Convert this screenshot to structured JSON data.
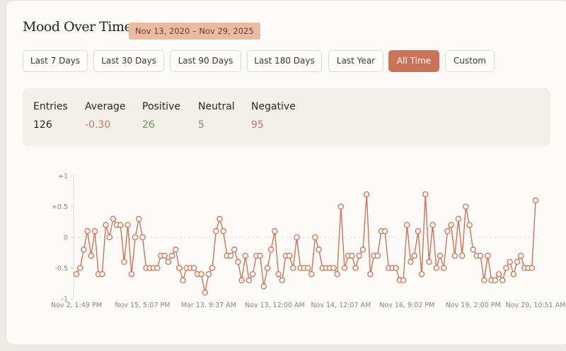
{
  "header": {
    "title": "Mood Over Time",
    "date_range": "Nov 13, 2020 – Nov 29, 2025"
  },
  "ranges": [
    {
      "label": "Last 7 Days",
      "active": false
    },
    {
      "label": "Last 30 Days",
      "active": false
    },
    {
      "label": "Last 90 Days",
      "active": false
    },
    {
      "label": "Last 180 Days",
      "active": false
    },
    {
      "label": "Last Year",
      "active": false
    },
    {
      "label": "All Time",
      "active": true
    },
    {
      "label": "Custom",
      "active": false
    }
  ],
  "stats": {
    "entries": {
      "label": "Entries",
      "value": "126"
    },
    "average": {
      "label": "Average",
      "value": "-0.30"
    },
    "positive": {
      "label": "Positive",
      "value": "26"
    },
    "neutral": {
      "label": "Neutral",
      "value": "5"
    },
    "negative": {
      "label": "Negative",
      "value": "95"
    }
  },
  "colors": {
    "accent": "#c7745a",
    "positive": "#6a9a6a",
    "neutral": "#8a8580",
    "negative": "#c47a6e",
    "line": "#c7745a"
  },
  "chart_data": {
    "type": "line",
    "title": "",
    "xlabel": "",
    "ylabel": "",
    "ylim": [
      -1,
      1
    ],
    "y_ticks": [
      "+1",
      "+0.5",
      "0",
      "-0.5",
      "-1"
    ],
    "y_tick_values": [
      1,
      0.5,
      0,
      -0.5,
      -1
    ],
    "zero_line": "dashed",
    "x_tick_labels": [
      "Nov 2, 1:49 PM",
      "Nov 15, 5:07 PM",
      "Mar 13, 9:37 AM",
      "Nov 13, 12:00 AM",
      "Nov 14, 12:07 AM",
      "Nov 16, 9:02 PM",
      "Nov 19, 2:00 PM",
      "Nov 29, 10:51 AM"
    ],
    "x_tick_indices": [
      0,
      18,
      36,
      54,
      72,
      90,
      108,
      125
    ],
    "series": [
      {
        "values": [
          -0.6,
          -0.5,
          -0.2,
          0.1,
          -0.3,
          0.1,
          -0.6,
          -0.6,
          0.2,
          0.0,
          0.3,
          0.2,
          0.2,
          -0.4,
          0.2,
          -0.6,
          0.0,
          0.3,
          0.0,
          -0.5,
          -0.5,
          -0.5,
          -0.5,
          -0.3,
          -0.3,
          -0.4,
          -0.3,
          -0.2,
          -0.5,
          -0.7,
          -0.5,
          -0.5,
          -0.5,
          -0.6,
          -0.6,
          -0.9,
          -0.6,
          -0.5,
          0.1,
          0.3,
          0.1,
          -0.3,
          -0.3,
          -0.2,
          -0.4,
          -0.7,
          -0.3,
          -0.7,
          -0.6,
          -0.3,
          -0.3,
          -0.8,
          -0.5,
          -0.2,
          0.1,
          -0.6,
          -0.7,
          -0.3,
          -0.3,
          -0.5,
          0.0,
          -0.5,
          -0.5,
          -0.5,
          -0.6,
          0.0,
          -0.2,
          -0.5,
          -0.5,
          -0.5,
          -0.5,
          -0.6,
          0.5,
          -0.5,
          -0.3,
          -0.3,
          -0.5,
          -0.3,
          -0.2,
          0.7,
          -0.6,
          -0.3,
          -0.3,
          0.1,
          0.1,
          -0.5,
          -0.5,
          -0.5,
          -0.7,
          -0.7,
          0.2,
          -0.4,
          -0.3,
          0.1,
          -0.6,
          0.7,
          -0.4,
          0.2,
          -0.5,
          -0.3,
          -0.5,
          0.1,
          0.2,
          -0.3,
          0.3,
          -0.3,
          0.5,
          0.2,
          -0.2,
          -0.3,
          -0.3,
          -0.7,
          -0.3,
          -0.7,
          -0.7,
          -0.6,
          -0.7,
          -0.5,
          -0.4,
          -0.6,
          -0.4,
          -0.3,
          -0.5,
          -0.5,
          -0.5,
          0.6
        ]
      }
    ]
  }
}
